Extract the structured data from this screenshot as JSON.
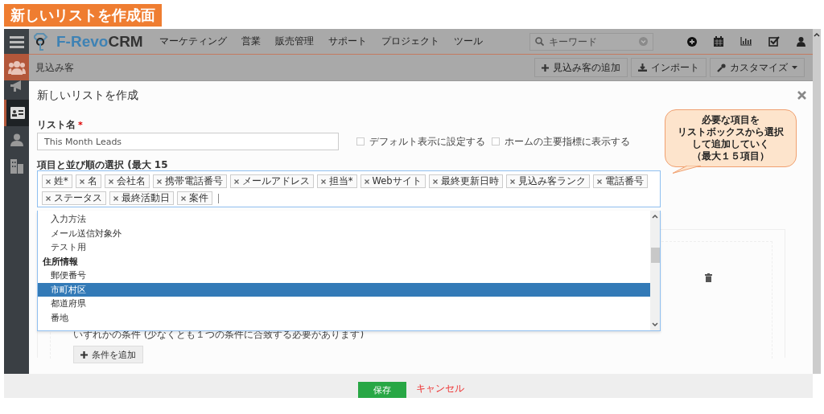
{
  "caption": "新しいリストを作成面",
  "navbar": {
    "brand_prefix": "F-Revo",
    "brand_suffix": "CRM",
    "menu": [
      "マーケティング",
      "営業",
      "販売管理",
      "サポート",
      "プロジェクト",
      "ツール"
    ],
    "search": {
      "placeholder": "キーワード"
    },
    "tools": [
      {
        "kind": "plus"
      },
      {
        "kind": "calendar"
      },
      {
        "kind": "chart"
      },
      {
        "kind": "task"
      },
      {
        "kind": "user"
      }
    ]
  },
  "sidebar": {
    "items": [
      {
        "kind": "people",
        "selected": true
      },
      {
        "kind": "megaphone",
        "selected": false
      },
      {
        "kind": "card",
        "selected": false,
        "hovered": true
      },
      {
        "kind": "person",
        "selected": false
      },
      {
        "kind": "building",
        "selected": false
      }
    ]
  },
  "module": {
    "title": "見込み客",
    "actions": [
      {
        "kind": "add",
        "label": "見込み客の追加"
      },
      {
        "kind": "import",
        "label": "インポート"
      },
      {
        "kind": "customize",
        "label": "カスタマイズ"
      }
    ]
  },
  "modal": {
    "title": "新しいリストを作成",
    "list_name": {
      "label": "リスト名",
      "required": true,
      "required_mark": "*",
      "value": "This Month Leads"
    },
    "options": [
      {
        "label": "デフォルト表示に設定する",
        "checked": false
      },
      {
        "label": "ホームの主要指標に表示する",
        "checked": false
      }
    ],
    "columns_label": "項目と並び順の選択 (最大 15",
    "tags": [
      {
        "label": "姓*"
      },
      {
        "label": "名"
      },
      {
        "label": "会社名"
      },
      {
        "label": "携帯電話番号"
      },
      {
        "label": "メールアドレス"
      },
      {
        "label": "担当*"
      },
      {
        "label": "Webサイト"
      },
      {
        "label": "最終更新日時"
      },
      {
        "label": "見込み客ランク"
      },
      {
        "label": "電話番号"
      },
      {
        "label": "ステータス"
      },
      {
        "label": "最終活動日"
      },
      {
        "label": "案件"
      }
    ],
    "dropdown": [
      {
        "kind": "option",
        "label": "入力方法",
        "selected": false
      },
      {
        "kind": "option",
        "label": "メール送信対象外",
        "selected": false
      },
      {
        "kind": "option",
        "label": "テスト用",
        "selected": false
      },
      {
        "kind": "group",
        "label": "住所情報",
        "children": [
          {
            "kind": "option",
            "label": "郵便番号",
            "selected": false
          },
          {
            "kind": "option",
            "label": "市町村区",
            "selected": true
          },
          {
            "kind": "option",
            "label": "都道府県",
            "selected": false
          },
          {
            "kind": "option",
            "label": "番地",
            "selected": false
          }
        ]
      }
    ],
    "conditions": {
      "any_label": "いずれかの条件 (少なくとも１つの条件に合致する必要があります)",
      "add_button": "条件を追加"
    }
  },
  "footer": {
    "save": "保存",
    "cancel": "キャンセル"
  },
  "callout": {
    "lines": [
      "必要な項目を",
      "リストボックスから選択",
      "して追加していく",
      "（最大１５項目）"
    ]
  }
}
